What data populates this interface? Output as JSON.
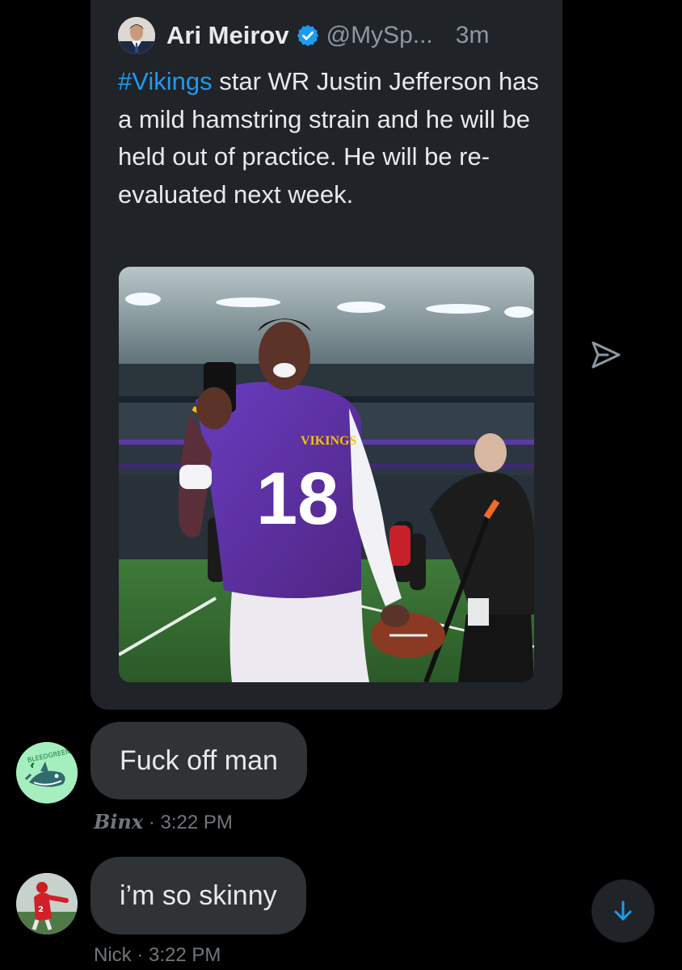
{
  "tweet": {
    "author_name": "Ari Meirov",
    "handle": "@MySp...",
    "time": "3m",
    "hashtag": "#Vikings",
    "text": " star WR Justin Jefferson has a mild hamstring strain and he will be held out of practice. He will be re-evaluated next week.",
    "media": {
      "jersey_team": "VIKINGS",
      "jersey_number": "18"
    },
    "colors": {
      "accent": "#1d9bf0",
      "card": "#202327",
      "vikings_purple": "#4f2683"
    }
  },
  "messages": [
    {
      "text": "Fuck off man",
      "sender": "Binx",
      "time": "3:22 PM",
      "avatar": {
        "badge_text": "BLEEDGREEN",
        "icon": "shark-avatar-icon"
      }
    },
    {
      "text": "i’m so skinny",
      "sender": "Nick",
      "time": "3:22 PM",
      "avatar": {
        "icon": "baseball-player-avatar-icon"
      }
    }
  ],
  "icons": {
    "share": "send-icon",
    "scroll": "arrow-down-icon",
    "verified": "verified-badge-icon"
  },
  "separator": " · "
}
